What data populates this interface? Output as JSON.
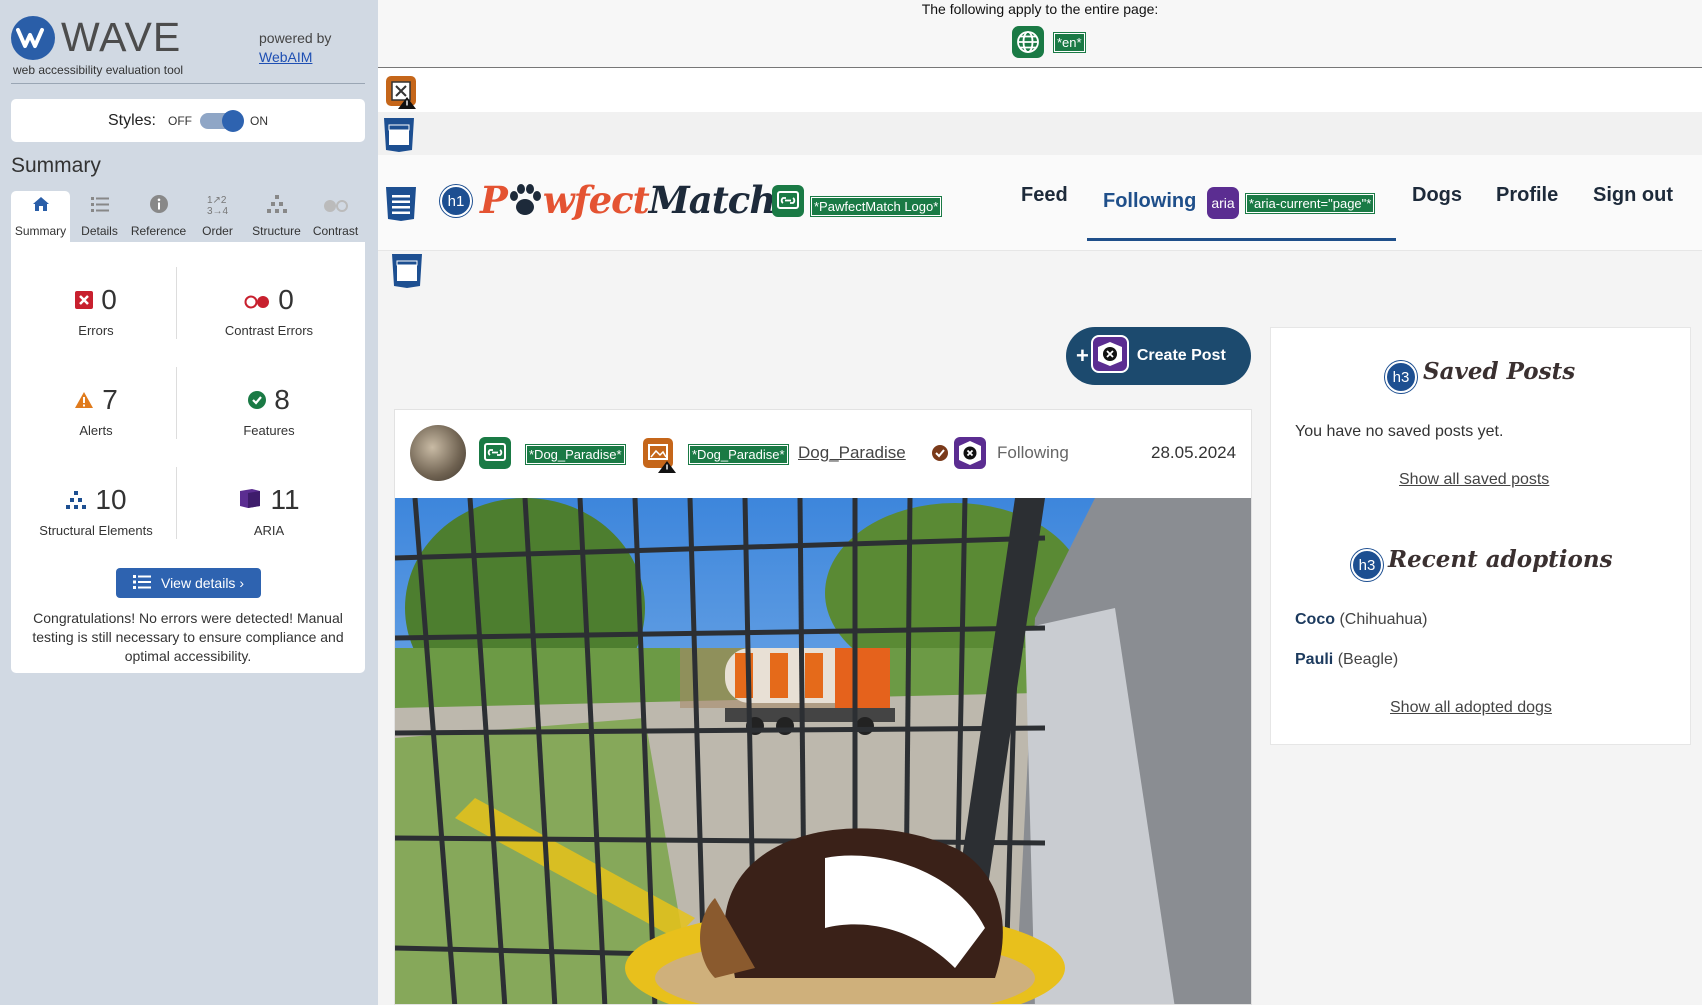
{
  "wave": {
    "title": "WAVE",
    "tagline": "web accessibility evaluation tool",
    "powered_by": "powered by",
    "webaim_link": "WebAIM",
    "styles_label": "Styles:",
    "styles_off": "OFF",
    "styles_on": "ON",
    "summary_heading": "Summary",
    "tabs": [
      {
        "label": "Summary",
        "icon": "home-icon"
      },
      {
        "label": "Details",
        "icon": "list-icon"
      },
      {
        "label": "Reference",
        "icon": "info-icon"
      },
      {
        "label": "Order",
        "icon": "order-icon"
      },
      {
        "label": "Structure",
        "icon": "structure-icon"
      },
      {
        "label": "Contrast",
        "icon": "contrast-icon"
      }
    ],
    "stats": {
      "errors": {
        "value": "0",
        "label": "Errors"
      },
      "contrast_errors": {
        "value": "0",
        "label": "Contrast Errors"
      },
      "alerts": {
        "value": "7",
        "label": "Alerts"
      },
      "features": {
        "value": "8",
        "label": "Features"
      },
      "structural": {
        "value": "10",
        "label": "Structural Elements"
      },
      "aria": {
        "value": "11",
        "label": "ARIA"
      }
    },
    "view_details": "View details ›",
    "congrats": "Congratulations! No errors were detected! Manual testing is still necessary to ensure compliance and optimal accessibility."
  },
  "page_bar": {
    "text": "The following apply to the entire page:",
    "lang_tag": "*en*"
  },
  "site": {
    "logo": {
      "part1": "P",
      "part2": "wfect",
      "part3": "Match"
    },
    "logo_alt_tag": "*PawfectMatch Logo*",
    "h1_badge": "h1",
    "nav": {
      "feed": "Feed",
      "following": "Following",
      "aria_badge": "aria",
      "aria_current_tag": "*aria-current=\"page\"*",
      "dogs": "Dogs",
      "profile": "Profile",
      "sign_out": "Sign out"
    },
    "create_post": "Create Post",
    "post": {
      "alt_tag_1": "*Dog_Paradise*",
      "alt_tag_2": "*Dog_Paradise*",
      "username": "Dog_Paradise",
      "follow_status": "Following",
      "date": "28.05.2024"
    },
    "sidebar": {
      "h3_badge": "h3",
      "saved_heading": "Saved Posts",
      "saved_empty": "You have no saved posts yet.",
      "saved_link": "Show all saved posts",
      "adoptions_heading": "Recent adoptions",
      "adoptions": [
        {
          "name": "Coco",
          "breed": "(Chihuahua)"
        },
        {
          "name": "Pauli",
          "breed": "(Beagle)"
        }
      ],
      "adoptions_link": "Show all adopted dogs"
    }
  },
  "colors": {
    "wave_blue": "#2e63b0",
    "feature_green": "#1a7a45",
    "aria_purple": "#5b2d91",
    "structure_blue": "#1d4f91",
    "alert_orange": "#e07b1d",
    "logo_orange": "#e45332",
    "navy": "#1c4a6e"
  }
}
